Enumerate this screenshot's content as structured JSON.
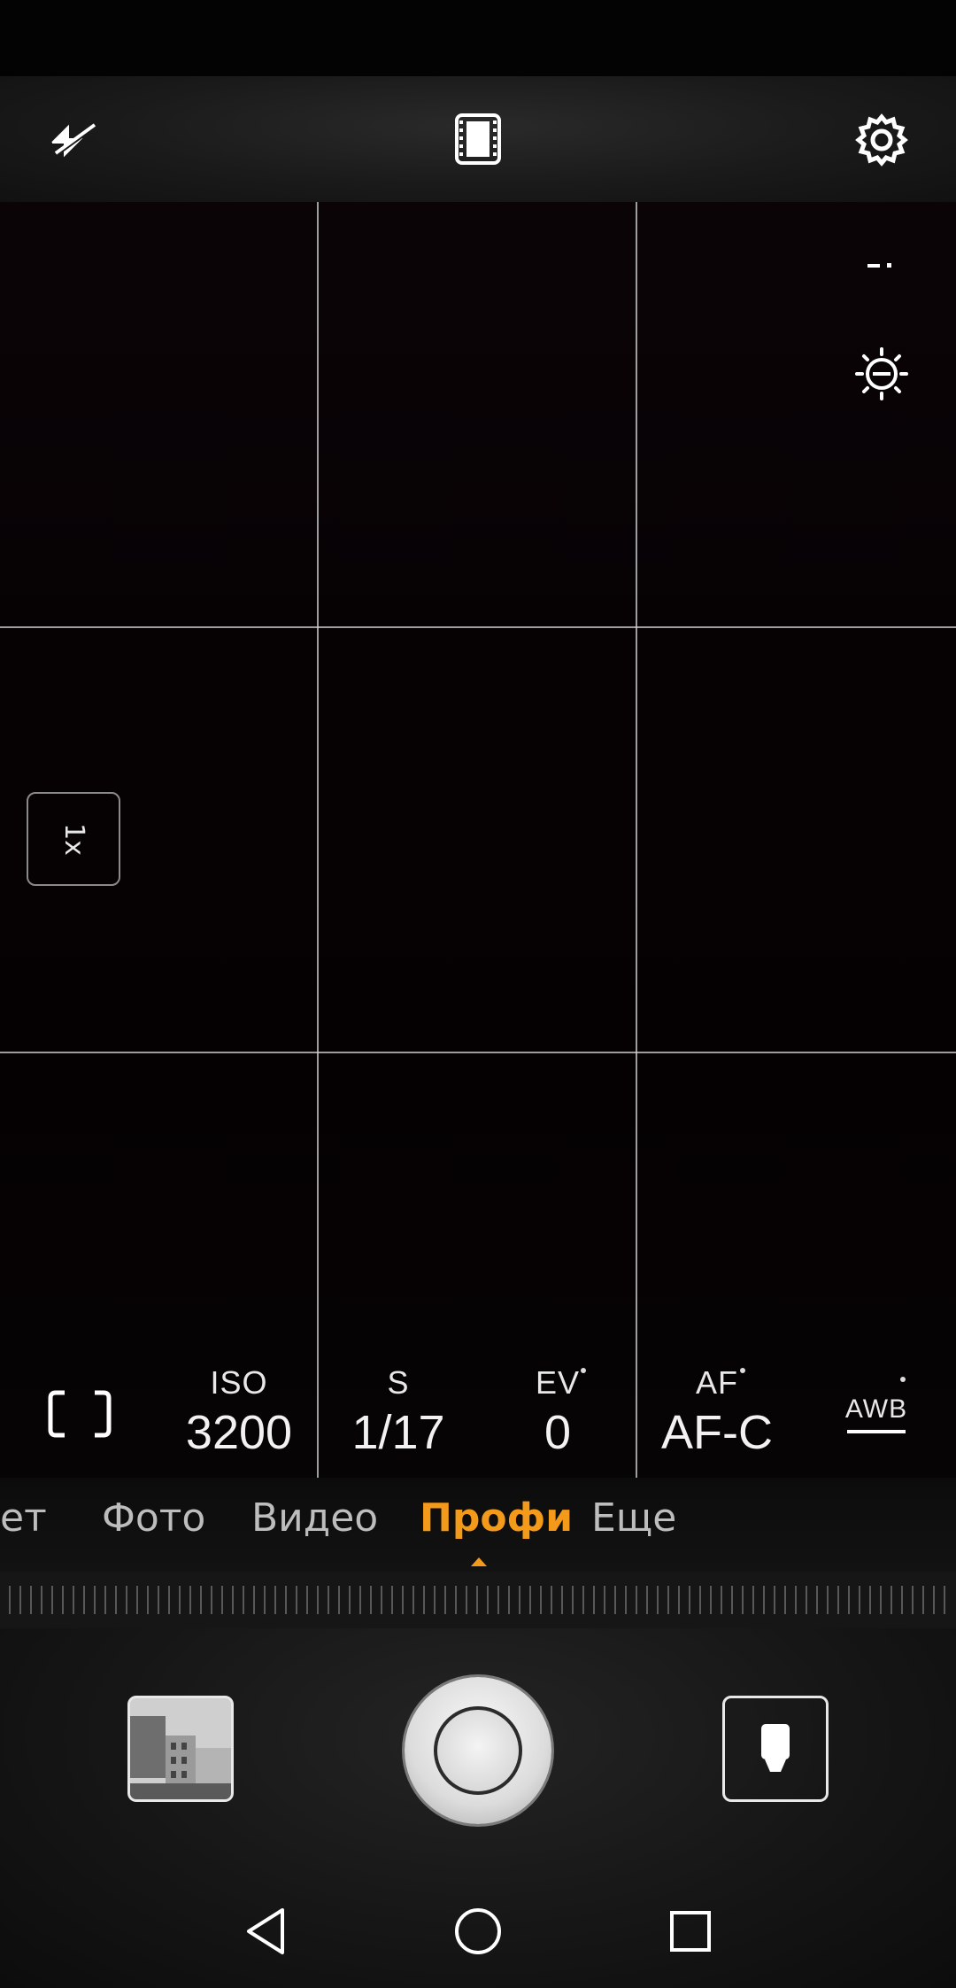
{
  "top_toolbar": {
    "flash_icon": "flash-off-icon",
    "mode_icon": "film-icon",
    "settings_icon": "gear-icon"
  },
  "side_controls": {
    "metering_icon": "metering-icon",
    "exposure_icon": "brightness-icon"
  },
  "zoom": {
    "label": "1x"
  },
  "pro_params": [
    {
      "label": "",
      "value": "",
      "icon": "metering-frame-icon"
    },
    {
      "label": "ISO",
      "value": "3200"
    },
    {
      "label": "S",
      "value": "1/17"
    },
    {
      "label": "EV",
      "value": "0"
    },
    {
      "label": "AF",
      "value": "AF-C"
    },
    {
      "label": "AWB",
      "value": ""
    }
  ],
  "modes": [
    {
      "label": "ет"
    },
    {
      "label": "Фото"
    },
    {
      "label": "Видео"
    },
    {
      "label": "Профи",
      "active": true
    },
    {
      "label": "Еще"
    }
  ],
  "colors": {
    "accent": "#f39a1a",
    "background": "#000000"
  },
  "bottom": {
    "gallery_icon": "gallery-thumbnail-icon",
    "shutter_icon": "shutter-icon",
    "switch_icon": "switch-camera-icon"
  },
  "navbar": {
    "back_icon": "back-triangle-icon",
    "home_icon": "home-circle-icon",
    "recents_icon": "recents-square-icon"
  }
}
